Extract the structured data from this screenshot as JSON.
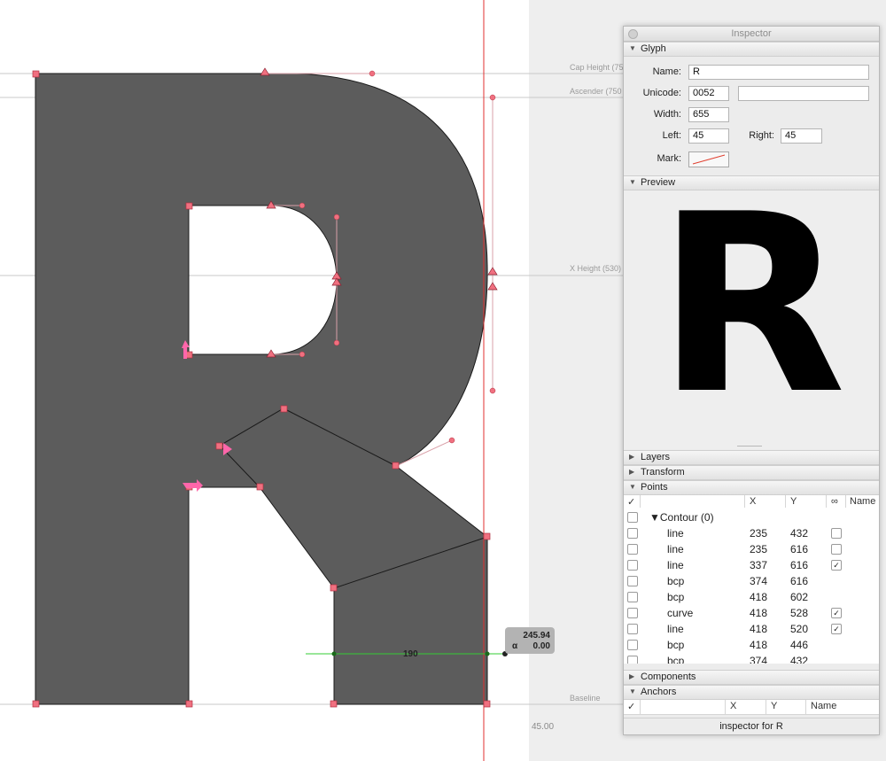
{
  "canvas": {
    "guides": [
      {
        "label": "Cap Height (75"
      },
      {
        "label": "Ascender (750"
      },
      {
        "label": "X Height (530)"
      },
      {
        "label": "Baseline"
      }
    ],
    "right_margin_label": "45.00",
    "measure": {
      "distance_label": "190"
    },
    "tooltip": {
      "value1": "245.94",
      "angle_symbol": "α",
      "value2": "0.00"
    },
    "colors": {
      "glyph_fill": "#5c5c5c",
      "guide_line": "#c8c8c8",
      "point_color": "#f07080",
      "measure_line": "#33cc33",
      "sidebearing_line": "#e03030"
    }
  },
  "inspector": {
    "title": "Inspector",
    "sections": {
      "glyph": "Glyph",
      "preview": "Preview",
      "layers": "Layers",
      "transform": "Transform",
      "points": "Points",
      "components": "Components",
      "anchors": "Anchors"
    },
    "glyph": {
      "name_label": "Name:",
      "name_value": "R",
      "unicode_label": "Unicode:",
      "unicode_value": "0052",
      "unicode_name_value": "",
      "width_label": "Width:",
      "width_value": "655",
      "left_label": "Left:",
      "left_value": "45",
      "right_label": "Right:",
      "right_value": "45",
      "mark_label": "Mark:"
    },
    "preview_char": "R",
    "points": {
      "headers": {
        "check": "✓",
        "x": "X",
        "y": "Y",
        "smooth": "∞",
        "name": "Name"
      },
      "contour_label": "Contour (0)",
      "rows": [
        {
          "type": "line",
          "x": "235",
          "y": "432",
          "smooth": ""
        },
        {
          "type": "line",
          "x": "235",
          "y": "616",
          "smooth": ""
        },
        {
          "type": "line",
          "x": "337",
          "y": "616",
          "smooth": "✓"
        },
        {
          "type": "bcp",
          "x": "374",
          "y": "616",
          "smooth": null
        },
        {
          "type": "bcp",
          "x": "418",
          "y": "602",
          "smooth": null
        },
        {
          "type": "curve",
          "x": "418",
          "y": "528",
          "smooth": "✓"
        },
        {
          "type": "line",
          "x": "418",
          "y": "520",
          "smooth": "✓"
        },
        {
          "type": "bcp",
          "x": "418",
          "y": "446",
          "smooth": null
        },
        {
          "type": "bcp",
          "x": "374",
          "y": "432",
          "smooth": null
        }
      ]
    },
    "anchors": {
      "headers": {
        "check": "✓",
        "x": "X",
        "y": "Y",
        "name": "Name"
      }
    },
    "status": "inspector for R"
  }
}
